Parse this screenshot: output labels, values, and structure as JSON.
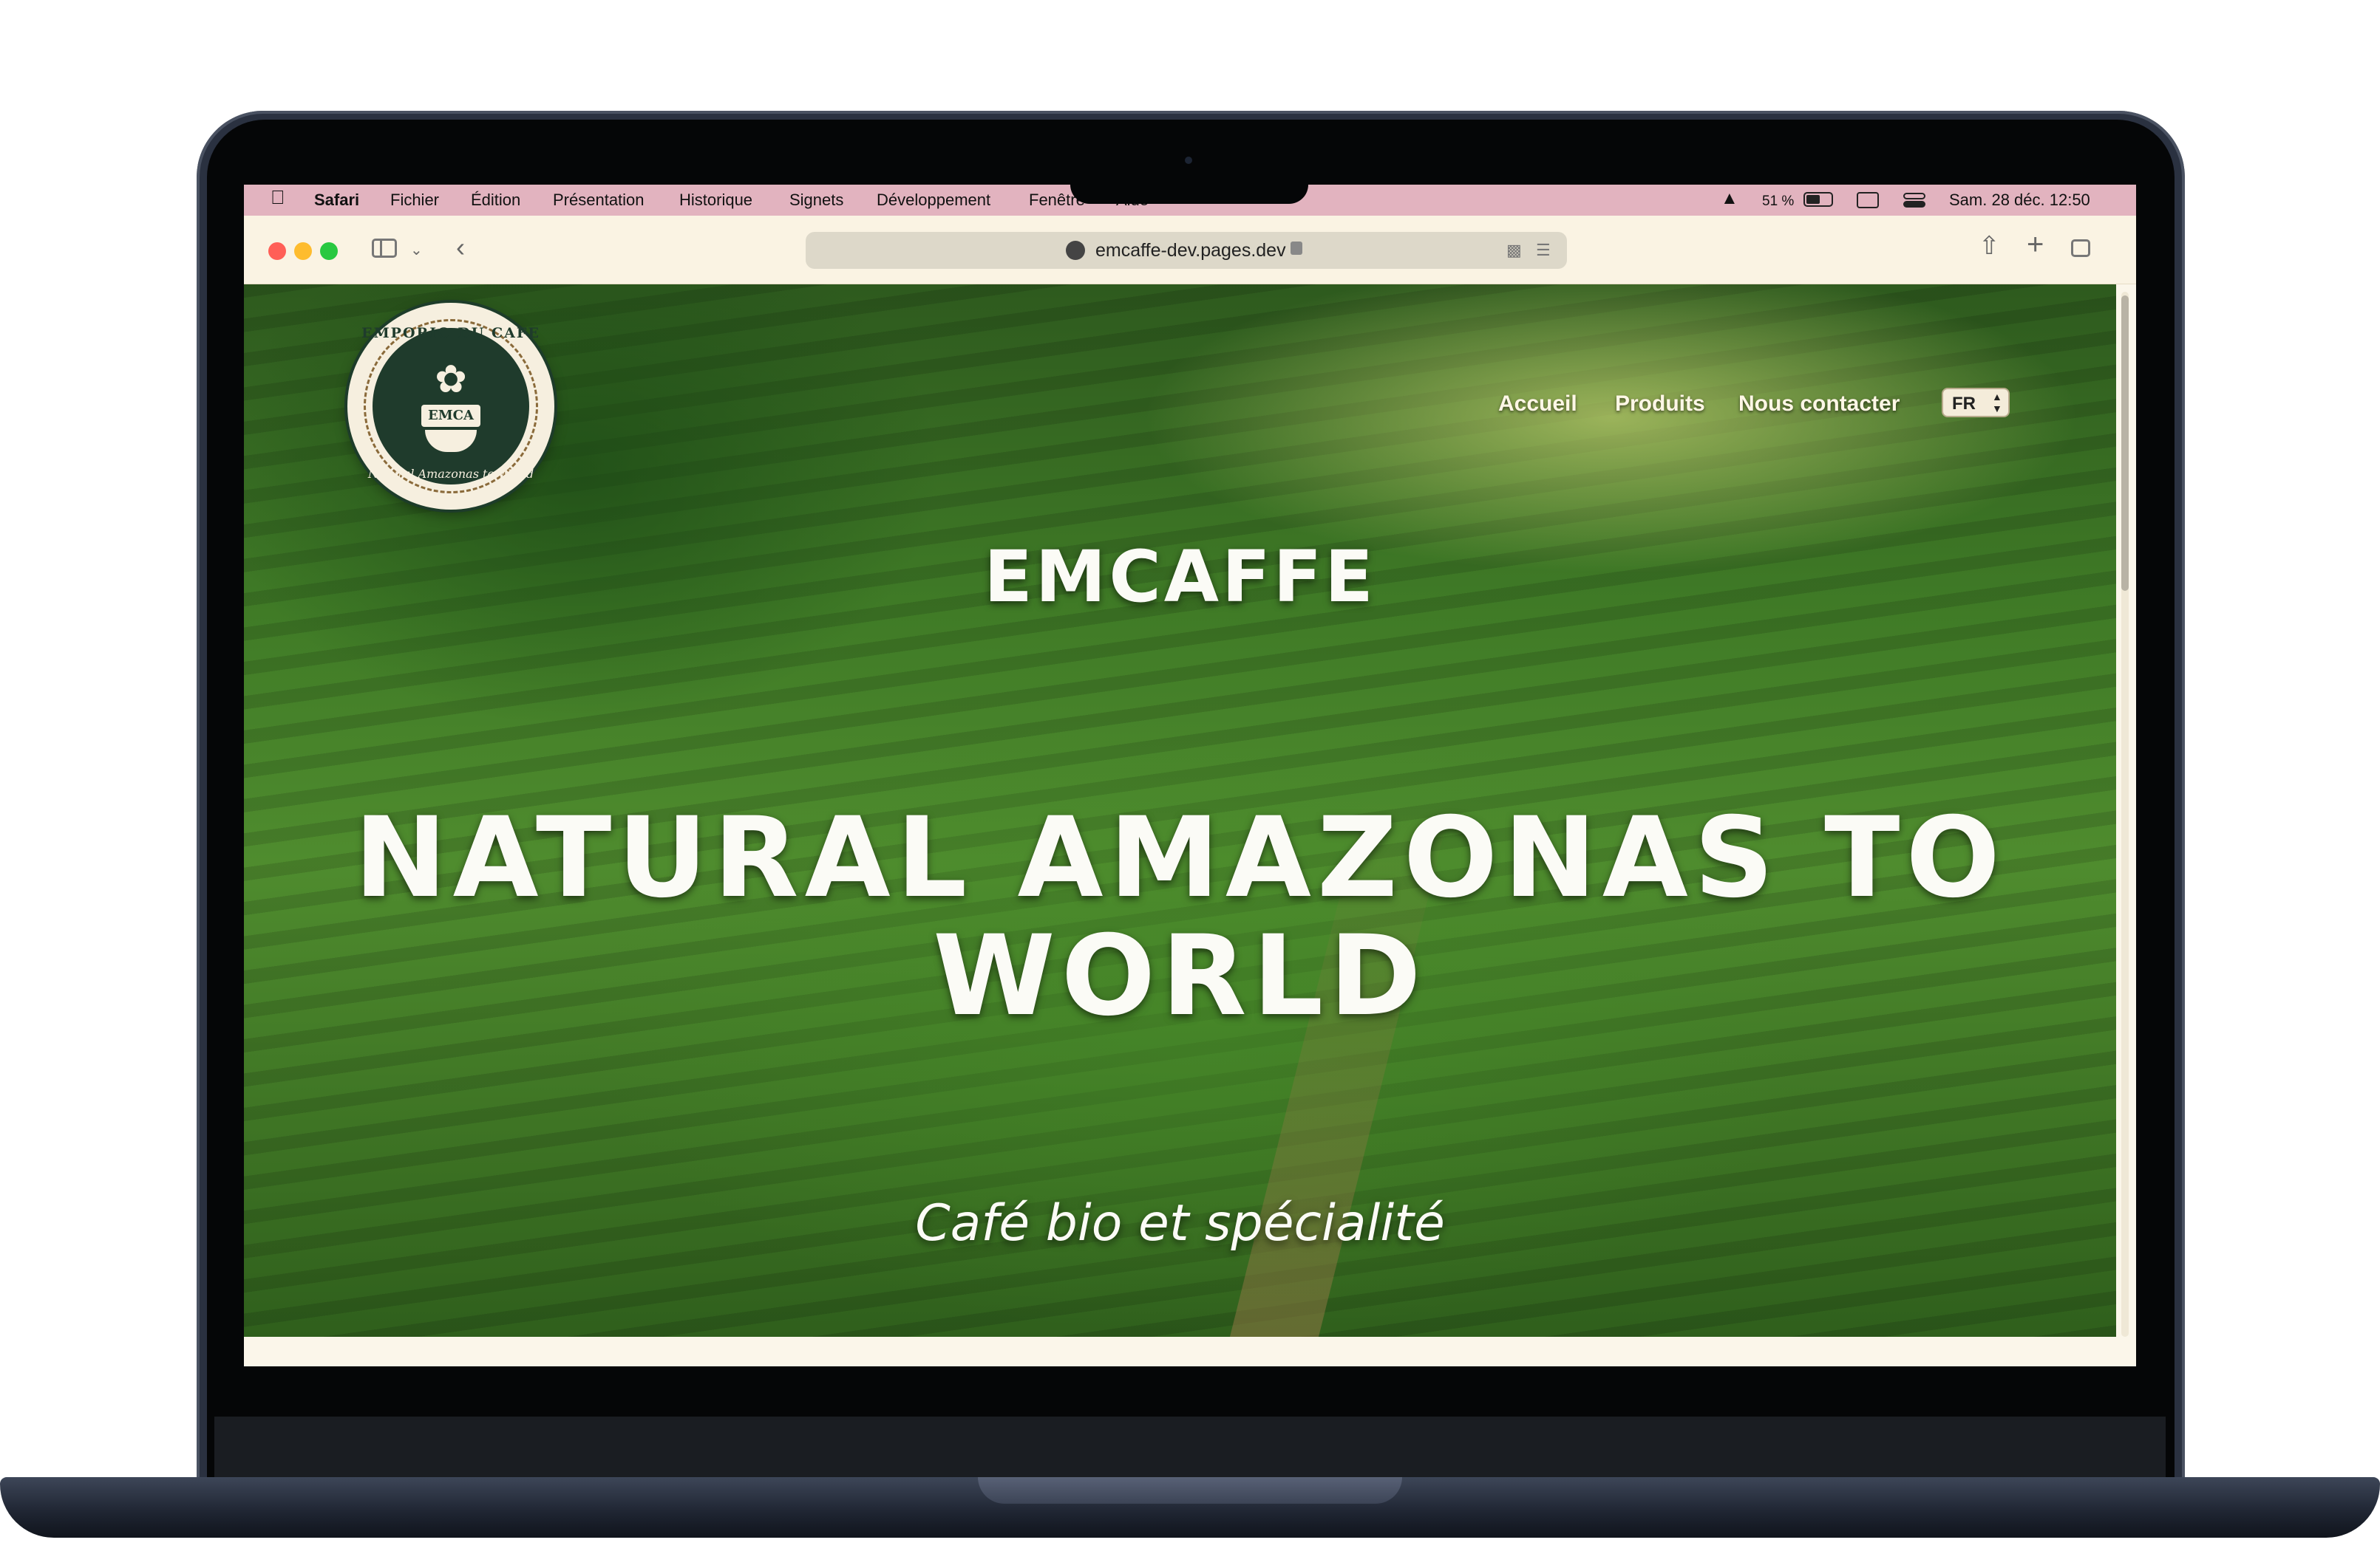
{
  "menubar": {
    "app": "Safari",
    "items": [
      "Fichier",
      "Édition",
      "Présentation",
      "Historique",
      "Signets",
      "Développement",
      "Fenêtre",
      "Aide"
    ],
    "battery": "51 %",
    "datetime": "Sam. 28 déc.  12:50"
  },
  "browser": {
    "url": "emcaffe-dev.pages.dev"
  },
  "site": {
    "logo": {
      "top_text": "EMPORIO DU CAFE",
      "center_text": "EMCA",
      "bottom_text": "Natural Amazonas to World"
    },
    "nav": {
      "home": "Accueil",
      "products": "Produits",
      "contact": "Nous contacter"
    },
    "language": "FR",
    "brand": "EMCAFFE",
    "headline_line1": "NATURAL AMAZONAS TO",
    "headline_line2": "WORLD",
    "tagline": "Café bio et spécialité"
  },
  "colors": {
    "menubar": "#e2b3bf",
    "toolbar": "#faf3e3",
    "hero_green": "#3f7a26",
    "logo_green": "#1f3b2c",
    "laptop_body": "#2a3140"
  }
}
